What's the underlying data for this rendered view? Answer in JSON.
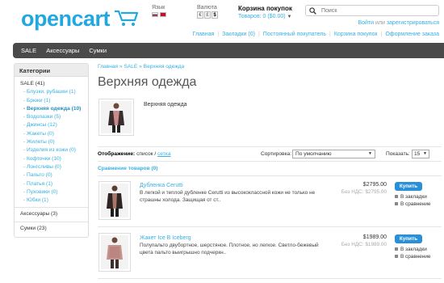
{
  "header": {
    "logo_text": "opencart",
    "language_label": "Язык",
    "currency_label": "Валюта",
    "currencies": [
      "€",
      "£",
      "$"
    ],
    "cart_title": "Корзина покупок",
    "cart_summary": "Товаров: 0 ($0.00)",
    "search_placeholder": "Поиск",
    "login_link": "Войти",
    "or_text": " или ",
    "register_link": "зарегистрироваться",
    "top_links": [
      "Главная",
      "Закладки (0)",
      "Постоянный покупатель",
      "Корзина покупок",
      "Оформление заказа"
    ]
  },
  "menu": [
    "SALE",
    "Аксессуары",
    "Сумки"
  ],
  "sidebar": {
    "title": "Категории",
    "parent": "SALE (41)",
    "items": [
      "- Блузки, рубашки (1)",
      "- Брюки (1)",
      "- Верхняя одежда (10)",
      "- Водолазки (5)",
      "- Джинсы (12)",
      "- Жакеты (0)",
      "- Жилеты (0)",
      "- Изделия из кожи (0)",
      "- Кофточки (10)",
      "- Лонгсливы (0)",
      "- Пальто (0)",
      "- Платья (1)",
      "- Пуховики (0)",
      "- Юбки (1)"
    ],
    "others": [
      "Аксессуары (3)",
      "Сумки (23)"
    ]
  },
  "breadcrumbs": [
    "Главная",
    "SALE",
    "Верхняя одежда"
  ],
  "breadcrumb_sep": " » ",
  "page_title": "Верхняя одежда",
  "category_description": "Верхняя одежда",
  "toolbar": {
    "display_label": "Отображение:",
    "display_list": "список",
    "display_sep": " / ",
    "display_grid": "сетка",
    "sort_label": "Сортировка:",
    "sort_value": "По умолчанию",
    "show_label": "Показать:",
    "show_value": "15"
  },
  "compare_link": "Сравнение товаров (0)",
  "products": [
    {
      "name": "Дубленка Cerutti",
      "desc": "В легкой и теплой дубленке Cerutti из высококлассной кожи не только не страшны холода. Защищая от ст..",
      "price": "$2795.00",
      "price_tax": "Без НДС: $2795.00",
      "buy": "Купить",
      "wishlist": "В закладки",
      "compare": "В сравнение"
    },
    {
      "name": "Жакет Ice B Iceberg",
      "desc": "Полупальто двубортное, шерстяное. Плотное, но легкое. Светло-бежевый цвета пальто выигрышно подчеркн..",
      "price": "$1989.00",
      "price_tax": "Без НДС: $1989.00",
      "buy": "Купить",
      "wishlist": "В закладки",
      "compare": "В сравнение"
    }
  ],
  "colors": {
    "accent": "#38b0e3",
    "menu_bg": "#4a4a4a",
    "buy_button": "#2a8fd9"
  }
}
